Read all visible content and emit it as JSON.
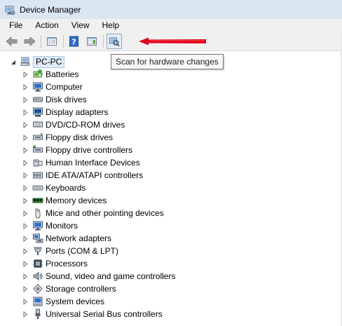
{
  "window": {
    "title": "Device Manager"
  },
  "menu": {
    "items": [
      {
        "label": "File"
      },
      {
        "label": "Action"
      },
      {
        "label": "View"
      },
      {
        "label": "Help"
      }
    ]
  },
  "toolbar": {
    "buttons": [
      {
        "icon": "back-arrow-icon"
      },
      {
        "icon": "forward-arrow-icon"
      },
      {
        "icon": "show-hide-console-tree-icon"
      },
      {
        "icon": "help-icon"
      },
      {
        "icon": "properties-icon"
      },
      {
        "icon": "scan-hardware-icon"
      }
    ],
    "accent_annotation_color": "#e0001b"
  },
  "tooltip": {
    "text": "Scan for hardware changes"
  },
  "tree": {
    "root": {
      "label": "PC-PC",
      "icon": "computer-icon"
    },
    "nodes": [
      {
        "label": "Batteries",
        "icon": "battery-icon"
      },
      {
        "label": "Computer",
        "icon": "monitor-icon"
      },
      {
        "label": "Disk drives",
        "icon": "disk-drive-icon"
      },
      {
        "label": "Display adapters",
        "icon": "display-adapter-icon"
      },
      {
        "label": "DVD/CD-ROM drives",
        "icon": "optical-drive-icon"
      },
      {
        "label": "Floppy disk drives",
        "icon": "floppy-drive-icon"
      },
      {
        "label": "Floppy drive controllers",
        "icon": "floppy-controller-icon"
      },
      {
        "label": "Human Interface Devices",
        "icon": "hid-icon"
      },
      {
        "label": "IDE ATA/ATAPI controllers",
        "icon": "ide-controller-icon"
      },
      {
        "label": "Keyboards",
        "icon": "keyboard-icon"
      },
      {
        "label": "Memory devices",
        "icon": "memory-icon"
      },
      {
        "label": "Mice and other pointing devices",
        "icon": "mouse-icon"
      },
      {
        "label": "Monitors",
        "icon": "monitor-icon"
      },
      {
        "label": "Network adapters",
        "icon": "network-adapter-icon"
      },
      {
        "label": "Ports (COM & LPT)",
        "icon": "port-icon"
      },
      {
        "label": "Processors",
        "icon": "processor-icon"
      },
      {
        "label": "Sound, video and game controllers",
        "icon": "sound-icon"
      },
      {
        "label": "Storage controllers",
        "icon": "storage-controller-icon"
      },
      {
        "label": "System devices",
        "icon": "system-device-icon"
      },
      {
        "label": "Universal Serial Bus controllers",
        "icon": "usb-icon"
      }
    ]
  }
}
